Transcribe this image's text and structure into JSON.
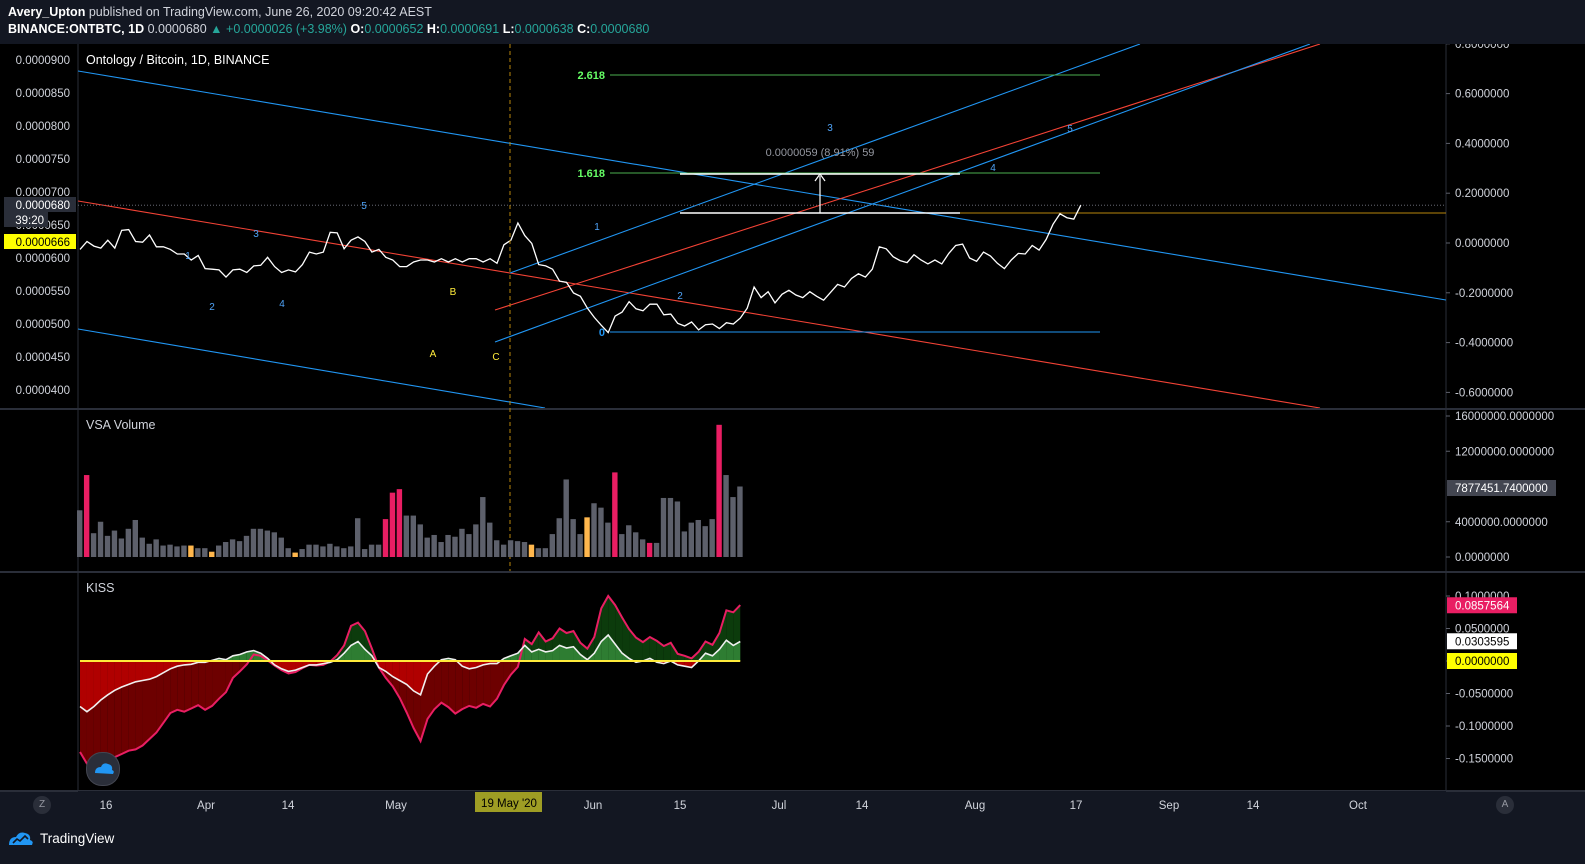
{
  "header": {
    "author": "Avery_Upton",
    "published_text": "published on TradingView.com, June 26, 2020 09:20:42 AEST",
    "symbol": "BINANCE:ONTBTC, 1D",
    "last_price": "0.0000680",
    "change": "▲ +0.0000026 (+3.98%)",
    "o_label": "O:",
    "o_value": "0.0000652",
    "h_label": "H:",
    "h_value": "0.0000691",
    "l_label": "L:",
    "l_value": "0.0000638",
    "c_label": "C:",
    "c_value": "0.0000680"
  },
  "footer": {
    "brand": "TradingView",
    "left_corner": "Z",
    "right_corner": "A"
  },
  "colors": {
    "background": "#000000",
    "ui": "#131722",
    "price_line": "#ffffff",
    "channel_blue": "#2196f3",
    "channel_red": "#f44336",
    "fib_green": "#4caf50",
    "fib_text": "#66ff66",
    "volume_gray": "#5d606b",
    "volume_pink": "#e91e63",
    "volume_orange": "#ffb74d",
    "kiss_red_area": "#6d0000",
    "kiss_green_area": "#0c3b0c",
    "zero_line": "#ffeb3b",
    "vline": "#b8860b"
  },
  "chart_data": [
    {
      "type": "line",
      "title": "Ontology / Bitcoin, 1D, BINANCE",
      "left_axis_ticks": [
        "0.0000900",
        "0.0000850",
        "0.0000800",
        "0.0000750",
        "0.0000700",
        "0.0000650",
        "0.0000600",
        "0.0000550",
        "0.0000500",
        "0.0000450",
        "0.0000400"
      ],
      "right_axis_ticks": [
        "0.8000000",
        "0.6000000",
        "0.4000000",
        "0.2000000",
        "0.0000000",
        "-0.2000000",
        "-0.4000000",
        "-0.6000000"
      ],
      "ylim": [
        3.8e-05,
        9.15e-05
      ],
      "x_tick_labels": [
        "16",
        "Apr",
        "14",
        "May",
        "Jun",
        "15",
        "Jul",
        "14",
        "Aug",
        "17",
        "Sep",
        "14",
        "Oct"
      ],
      "crosshair_date": "19 May '20",
      "price_badges": {
        "last": "0.0000680",
        "countdown": "39:20",
        "highlight": "0.0000666"
      },
      "series": [
        {
          "values": [
            6.13e-05,
            6.25e-05,
            6.18e-05,
            6.15e-05,
            6.27e-05,
            6.15e-05,
            6.42e-05,
            6.43e-05,
            6.25e-05,
            6.24e-05,
            6.35e-05,
            6.17e-05,
            6.17e-05,
            6.13e-05,
            6.06e-05,
            6.06e-05,
            5.97e-05,
            6.04e-05,
            5.84e-05,
            5.83e-05,
            5.82e-05,
            5.71e-05,
            5.82e-05,
            5.83e-05,
            5.78e-05,
            5.88e-05,
            5.89e-05,
            6.01e-05,
            5.87e-05,
            5.78e-05,
            5.82e-05,
            5.79e-05,
            5.9e-05,
            6.09e-05,
            6.06e-05,
            6.09e-05,
            6.39e-05,
            6.38e-05,
            6.14e-05,
            6.27e-05,
            6.32e-05,
            6.25e-05,
            6.09e-05,
            6.13e-05,
            6.01e-05,
            5.97e-05,
            5.87e-05,
            5.87e-05,
            5.94e-05,
            5.97e-05,
            5.97e-05,
            5.94e-05,
            5.99e-05,
            5.94e-05,
            5.99e-05,
            5.94e-05,
            5.99e-05,
            5.99e-05,
            5.94e-05,
            5.99e-05,
            5.92e-05,
            6.2e-05,
            6.27e-05,
            6.53e-05,
            6.34e-05,
            6.22e-05,
            5.9e-05,
            5.88e-05,
            5.83e-05,
            5.65e-05,
            5.63e-05,
            5.47e-05,
            5.42e-05,
            5.24e-05,
            5.1e-05,
            4.98e-05,
            4.87e-05,
            5.12e-05,
            5.18e-05,
            5.34e-05,
            5.23e-05,
            5.2e-05,
            5.3e-05,
            5.3e-05,
            5.14e-05,
            5.15e-05,
            5.01e-05,
            4.97e-05,
            5.03e-05,
            4.91e-05,
            4.99e-05,
            5e-05,
            4.93e-05,
            5.02e-05,
            5e-05,
            5.09e-05,
            5.24e-05,
            5.56e-05,
            5.4e-05,
            5.49e-05,
            5.32e-05,
            5.45e-05,
            5.51e-05,
            5.44e-05,
            5.4e-05,
            5.49e-05,
            5.42e-05,
            5.36e-05,
            5.48e-05,
            5.6e-05,
            5.56e-05,
            5.69e-05,
            5.76e-05,
            5.71e-05,
            5.83e-05,
            6.17e-05,
            6.14e-05,
            6.02e-05,
            5.96e-05,
            5.93e-05,
            6.05e-05,
            5.97e-05,
            5.91e-05,
            5.97e-05,
            5.91e-05,
            6.07e-05,
            6.19e-05,
            6.21e-05,
            6e-05,
            5.95e-05,
            6.09e-05,
            6.03e-05,
            5.92e-05,
            5.84e-05,
            5.97e-05,
            6.07e-05,
            6.06e-05,
            6.19e-05,
            6.12e-05,
            6.28e-05,
            6.51e-05,
            6.67e-05,
            6.61e-05,
            6.59e-05,
            6.8e-05
          ]
        }
      ],
      "fib_levels": [
        {
          "label": "2.618",
          "value": 8.73e-05
        },
        {
          "label": "1.618",
          "value": 7.23e-05
        },
        {
          "label": "0",
          "value": 4.72e-05
        }
      ],
      "measure_label": "0.0000059 (8.91%) 59",
      "wave_labels": [
        {
          "text": "1",
          "color": "#4fa3f7"
        },
        {
          "text": "2",
          "color": "#4fa3f7"
        },
        {
          "text": "3",
          "color": "#4fa3f7"
        },
        {
          "text": "4",
          "color": "#4fa3f7"
        },
        {
          "text": "5",
          "color": "#4fa3f7"
        },
        {
          "text": "A",
          "color": "#ffeb3b"
        },
        {
          "text": "B",
          "color": "#ffeb3b"
        },
        {
          "text": "C",
          "color": "#ffeb3b"
        },
        {
          "text": "1",
          "color": "#4fa3f7"
        },
        {
          "text": "2",
          "color": "#4fa3f7"
        },
        {
          "text": "3",
          "color": "#4fa3f7"
        },
        {
          "text": "4",
          "color": "#4fa3f7"
        },
        {
          "text": "5",
          "color": "#4fa3f7"
        }
      ]
    },
    {
      "type": "bar",
      "title": "VSA Volume",
      "right_axis_ticks": [
        "16000000.0000000",
        "12000000.0000000",
        "4000000.0000000",
        "0.0000000"
      ],
      "last_value_badge": "7877451.7400000",
      "ylim": [
        0,
        16000000
      ],
      "values": [
        5300000,
        9300000,
        2700000,
        4000000,
        2400000,
        3000000,
        2100000,
        3200000,
        4200000,
        2200000,
        1500000,
        2000000,
        1300000,
        1400000,
        1200000,
        1300000,
        1300000,
        1000000,
        1000000,
        600000,
        1300000,
        1700000,
        2000000,
        1800000,
        2400000,
        3200000,
        3200000,
        3000000,
        2800000,
        2200000,
        1000000,
        500000,
        900000,
        1400000,
        1400000,
        1200000,
        1500000,
        1200000,
        1000000,
        1200000,
        4400000,
        900000,
        1400000,
        1400000,
        4300000,
        7300000,
        7700000,
        4700000,
        4700000,
        3700000,
        2200000,
        2500000,
        1700000,
        2500000,
        2300000,
        3200000,
        2600000,
        3700000,
        6800000,
        3900000,
        1900000,
        1400000,
        1900000,
        1800000,
        1700000,
        1400000,
        1000000,
        1000000,
        2600000,
        4400000,
        8800000,
        4300000,
        2600000,
        4500000,
        6100000,
        5600000,
        3900000,
        9600000,
        2600000,
        3600000,
        2800000,
        2000000,
        1600000,
        1600000,
        6700000,
        6700000,
        6300000,
        2900000,
        3900000,
        4200000,
        3500000,
        4300000,
        15000000,
        9300000,
        6800000,
        8000000
      ],
      "bar_colors": [
        "g",
        "p",
        "g",
        "g",
        "g",
        "g",
        "g",
        "g",
        "g",
        "g",
        "g",
        "g",
        "g",
        "g",
        "g",
        "g",
        "o",
        "g",
        "g",
        "o",
        "g",
        "g",
        "g",
        "g",
        "g",
        "g",
        "g",
        "g",
        "g",
        "g",
        "g",
        "o",
        "g",
        "g",
        "g",
        "g",
        "g",
        "g",
        "g",
        "g",
        "g",
        "g",
        "g",
        "g",
        "p",
        "p",
        "p",
        "g",
        "g",
        "g",
        "g",
        "g",
        "g",
        "g",
        "g",
        "g",
        "g",
        "g",
        "g",
        "g",
        "g",
        "g",
        "g",
        "g",
        "g",
        "o",
        "g",
        "g",
        "g",
        "g",
        "g",
        "g",
        "g",
        "o",
        "g",
        "g",
        "g",
        "p",
        "g",
        "g",
        "g",
        "g",
        "p",
        "g",
        "g",
        "g",
        "g",
        "g",
        "g",
        "g",
        "g",
        "g",
        "p",
        "g",
        "g",
        "g"
      ]
    },
    {
      "type": "area",
      "title": "KISS",
      "right_axis_ticks": [
        "0.1000000",
        "0.0500000",
        "0.0000000",
        "-0.0500000",
        "-0.1000000",
        "-0.1500000"
      ],
      "badges": {
        "red": "0.0857564",
        "white": "0.0303595",
        "yellow": "0.0000000"
      },
      "ylim": [
        -0.18,
        0.108
      ],
      "series": [
        {
          "values": [
            -0.14,
            -0.158,
            -0.155,
            -0.15,
            -0.149,
            -0.148,
            -0.143,
            -0.138,
            -0.136,
            -0.13,
            -0.12,
            -0.11,
            -0.095,
            -0.08,
            -0.075,
            -0.078,
            -0.073,
            -0.068,
            -0.075,
            -0.069,
            -0.058,
            -0.048,
            -0.026,
            -0.016,
            -0.005,
            0.01,
            0.008,
            0.001,
            -0.007,
            -0.014,
            -0.019,
            -0.017,
            -0.011,
            -0.006,
            -0.007,
            -0.006,
            -0.001,
            0.009,
            0.024,
            0.054,
            0.059,
            0.046,
            0.019,
            -0.01,
            -0.026,
            -0.039,
            -0.057,
            -0.079,
            -0.103,
            -0.123,
            -0.089,
            -0.074,
            -0.064,
            -0.071,
            -0.081,
            -0.074,
            -0.069,
            -0.072,
            -0.066,
            -0.07,
            -0.058,
            -0.037,
            -0.021,
            -0.009,
            0.034,
            0.026,
            0.044,
            0.03,
            0.035,
            0.05,
            0.043,
            0.046,
            0.028,
            0.019,
            0.037,
            0.081,
            0.1,
            0.086,
            0.067,
            0.049,
            0.036,
            0.029,
            0.037,
            0.031,
            0.023,
            0.028,
            0.011,
            0.008,
            0.004,
            0.014,
            0.03,
            0.025,
            0.043,
            0.078,
            0.075,
            0.086
          ]
        },
        {
          "values": [
            -0.07,
            -0.078,
            -0.07,
            -0.06,
            -0.052,
            -0.045,
            -0.04,
            -0.036,
            -0.032,
            -0.03,
            -0.028,
            -0.024,
            -0.018,
            -0.012,
            -0.008,
            -0.006,
            -0.005,
            -0.002,
            -0.002,
            0.001,
            0.004,
            0.002,
            0.008,
            0.01,
            0.014,
            0.016,
            0.012,
            0.004,
            -0.006,
            -0.012,
            -0.016,
            -0.014,
            -0.01,
            -0.006,
            -0.006,
            -0.004,
            -0.002,
            0.002,
            0.012,
            0.024,
            0.03,
            0.018,
            0.008,
            -0.01,
            -0.016,
            -0.024,
            -0.03,
            -0.036,
            -0.046,
            -0.052,
            -0.02,
            -0.008,
            0.002,
            0.004,
            0.002,
            -0.008,
            -0.012,
            -0.01,
            -0.006,
            -0.004,
            -0.004,
            0.004,
            0.008,
            0.012,
            0.024,
            0.014,
            0.018,
            0.014,
            0.016,
            0.024,
            0.02,
            0.022,
            0.01,
            0.002,
            0.012,
            0.03,
            0.04,
            0.026,
            0.012,
            0.004,
            -0.002,
            0.0,
            0.004,
            -0.002,
            -0.004,
            0.0,
            -0.006,
            -0.008,
            -0.01,
            0.0,
            0.012,
            0.008,
            0.018,
            0.032,
            0.024,
            0.03
          ]
        }
      ]
    }
  ]
}
